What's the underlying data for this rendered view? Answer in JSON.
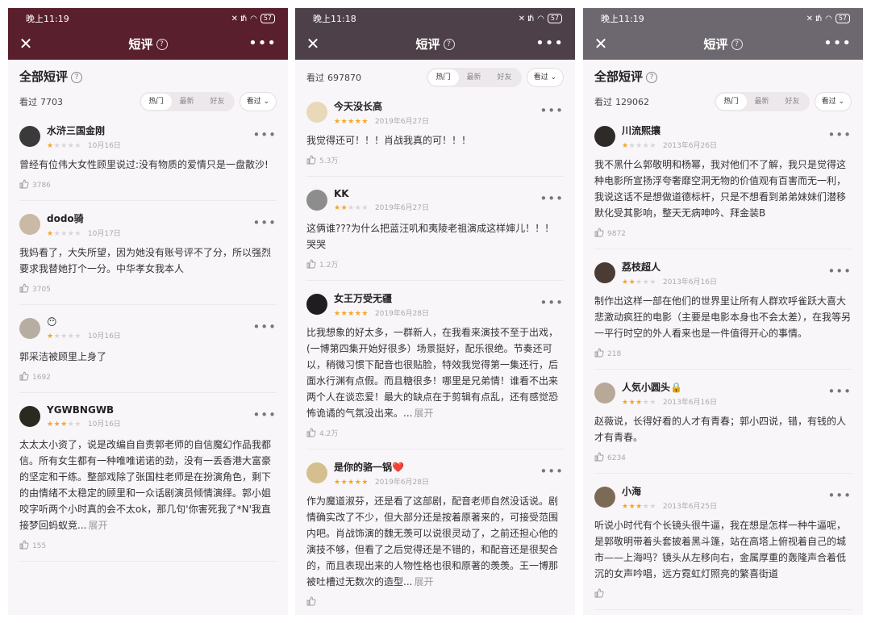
{
  "panels": [
    {
      "time": "晚上11:19",
      "battery": "57",
      "title": "短评",
      "section_title": "全部短评",
      "seen_label": "看过",
      "seen_count": "7703",
      "tabs": [
        "热门",
        "最新",
        "好友"
      ],
      "filter": "看过",
      "reviews": [
        {
          "name": "水浒三国金刚",
          "stars": 1,
          "date": "10月16日",
          "text": "曾经有位伟大女性顾里说过:没有物质的爱情只是一盘散沙!",
          "expand": "",
          "likes": "3786",
          "avatar_color": "#3a3a3a"
        },
        {
          "name": "dodo骑",
          "stars": 1,
          "date": "10月17日",
          "text": "我妈看了，大失所望，因为她没有账号评不了分，所以强烈要求我替她打个一分。中华孝女我本人",
          "expand": "",
          "likes": "3705",
          "avatar_color": "#c9b9a5"
        },
        {
          "name": "😶",
          "stars": 1,
          "date": "10月16日",
          "text": "郭采洁被顾里上身了",
          "expand": "",
          "likes": "1692",
          "avatar_color": "#b7aea2"
        },
        {
          "name": "YGWBNGWB",
          "stars": 3,
          "date": "10月16日",
          "text": "太太太小资了，说是改编自自责郭老师的自信魔幻作品我都信。所有女生都有一种唯唯诺诺的劲，没有一丢香港大富豪的坚定和干练。整部戏除了张国柱老师是在扮演角色，剩下的由情绪不太稳定的顾里和一众话剧演员倾情演绎。郭小姐咬字听两个小时真的会不太ok，那几句'你害死我了*N'我直接梦回蚂蚁竞...",
          "expand": "展开",
          "likes": "155",
          "avatar_color": "#2b2a20"
        }
      ]
    },
    {
      "time": "晚上11:18",
      "battery": "57",
      "title": "短评",
      "section_title": "",
      "seen_label": "看过",
      "seen_count": "697870",
      "tabs": [
        "热门",
        "最新",
        "好友"
      ],
      "filter": "看过",
      "reviews": [
        {
          "name": "今天没长高",
          "stars": 5,
          "date": "2019年6月27日",
          "text": "我觉得还可！！！肖战我真的可！！！",
          "expand": "",
          "likes": "5.3万",
          "avatar_color": "#e8d9b8"
        },
        {
          "name": "KK",
          "stars": 2,
          "date": "2019年6月27日",
          "text": "这俩谁???为什么把蓝汪叽和夷陵老祖演成这样婶儿！！！哭哭",
          "expand": "",
          "likes": "1.2万",
          "avatar_color": "#8d8d8d"
        },
        {
          "name": "女王万受无疆",
          "stars": 5,
          "date": "2019年6月28日",
          "text": "比我想象的好太多，一群新人，在我看来演技不至于出戏，(一博第四集开始好很多）场景挺好，配乐很绝。节奏还可以，稍微习惯下配音也很贴脸，特效我觉得第一集还行，后面水行渊有点假。而且糖很多！哪里是兄弟情！谁看不出来两个人在谈恋爱！最大的缺点在于剪辑有点乱，还有感觉恐怖诡谲的气氛没出来。...",
          "expand": "展开",
          "likes": "4.2万",
          "avatar_color": "#1e1e1e"
        },
        {
          "name": "是你的骆一锅❤️",
          "stars": 5,
          "date": "2019年6月28日",
          "text": "作为魔道淑芬，还是看了这部剧，配音老师自然没话说。剧情确实改了不少，但大部分还是按着原著来的，可接受范围内吧。肖战饰演的魏无羡可以说很灵动了，之前还担心他的演技不够，但看了之后觉得还是不错的，和配音还是很契合的，而且表现出来的人物性格也很和原著的羡羡。王一博那被吐槽过无数次的造型...",
          "expand": "展开",
          "likes": "",
          "avatar_color": "#d4c08e"
        }
      ]
    },
    {
      "time": "晚上11:19",
      "battery": "57",
      "title": "短评",
      "section_title": "全部短评",
      "seen_label": "看过",
      "seen_count": "129062",
      "tabs": [
        "热门",
        "最新",
        "好友"
      ],
      "filter": "看过",
      "reviews": [
        {
          "name": "川流熙攘",
          "stars": 1,
          "date": "2013年6月26日",
          "text": "我不黑什么郭敬明和杨幂，我对他们不了解，我只是觉得这种电影所宣扬浮夸奢靡空洞无物的价值观有百害而无一利，我说这话不是想做道德标杆，只是不想看到弟弟妹妹们潜移默化受其影响，整天无病呻吟、拜金装B",
          "expand": "",
          "likes": "9872",
          "avatar_color": "#2e2a28"
        },
        {
          "name": "荔枝超人",
          "stars": 2,
          "date": "2013年6月16日",
          "text": "制作出这样一部在他们的世界里让所有人群欢呼雀跃大喜大悲激动疯狂的电影（主要是电影本身也不会太差），在我等另一平行时空的外人看来也是一件值得开心的事情。",
          "expand": "",
          "likes": "218",
          "avatar_color": "#4a3b35"
        },
        {
          "name": "人気小圆头🔒",
          "stars": 3,
          "date": "2013年6月16日",
          "text": "赵薇说，长得好看的人才有青春；郭小四说，错，有钱的人才有青春。",
          "expand": "",
          "likes": "6234",
          "avatar_color": "#b8a898"
        },
        {
          "name": "小海",
          "stars": 3,
          "date": "2013年6月25日",
          "text": "听说小时代有个长镜头很牛逼，我在想是怎样一种牛逼呢，是郭敬明带着头套披着黑斗篷，站在高塔上俯视着自己的城市——上海吗？镜头从左移向右，金属厚重的轰隆声合着低沉的女声吟唱，远方霓虹灯照亮的繁喜街道",
          "expand": "",
          "likes": "",
          "avatar_color": "#7b6a55"
        }
      ]
    }
  ]
}
